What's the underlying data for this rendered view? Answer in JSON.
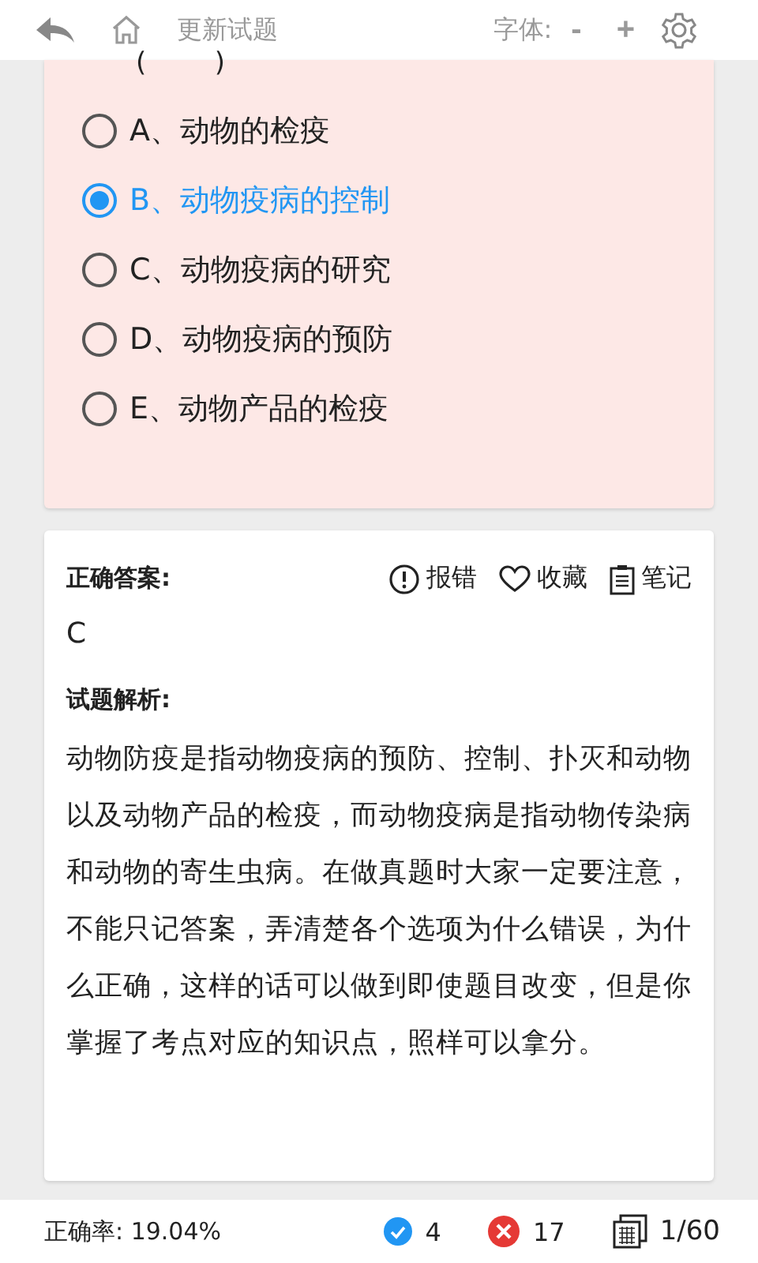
{
  "header": {
    "title": "更新试题",
    "font_label": "字体:",
    "font_minus": "-",
    "font_plus": "+"
  },
  "question": {
    "blank": "(        )",
    "options": [
      {
        "label": "A、动物的检疫",
        "selected": false
      },
      {
        "label": "B、动物疫病的控制",
        "selected": true
      },
      {
        "label": "C、动物疫病的研究",
        "selected": false
      },
      {
        "label": "D、动物疫病的预防",
        "selected": false
      },
      {
        "label": "E、动物产品的检疫",
        "selected": false
      }
    ]
  },
  "answer": {
    "heading": "正确答案:",
    "actions": [
      {
        "kind": "report",
        "label": "报错"
      },
      {
        "kind": "favorite",
        "label": "收藏"
      },
      {
        "kind": "notes",
        "label": "笔记"
      }
    ],
    "value": "C",
    "analysis_heading": "试题解析:",
    "analysis": "动物防疫是指动物疫病的预防、控制、扑灭和动物以及动物产品的检疫，而动物疫病是指动物传染病和动物的寄生虫病。在做真题时大家一定要注意，不能只记答案，弄清楚各个选项为什么错误，为什么正确，这样的话可以做到即使题目改变，但是你掌握了考点对应的知识点，照样可以拿分。"
  },
  "footer": {
    "accuracy": "正确率: 19.04%",
    "correct": "4",
    "wrong": "17",
    "progress": "1/60"
  }
}
